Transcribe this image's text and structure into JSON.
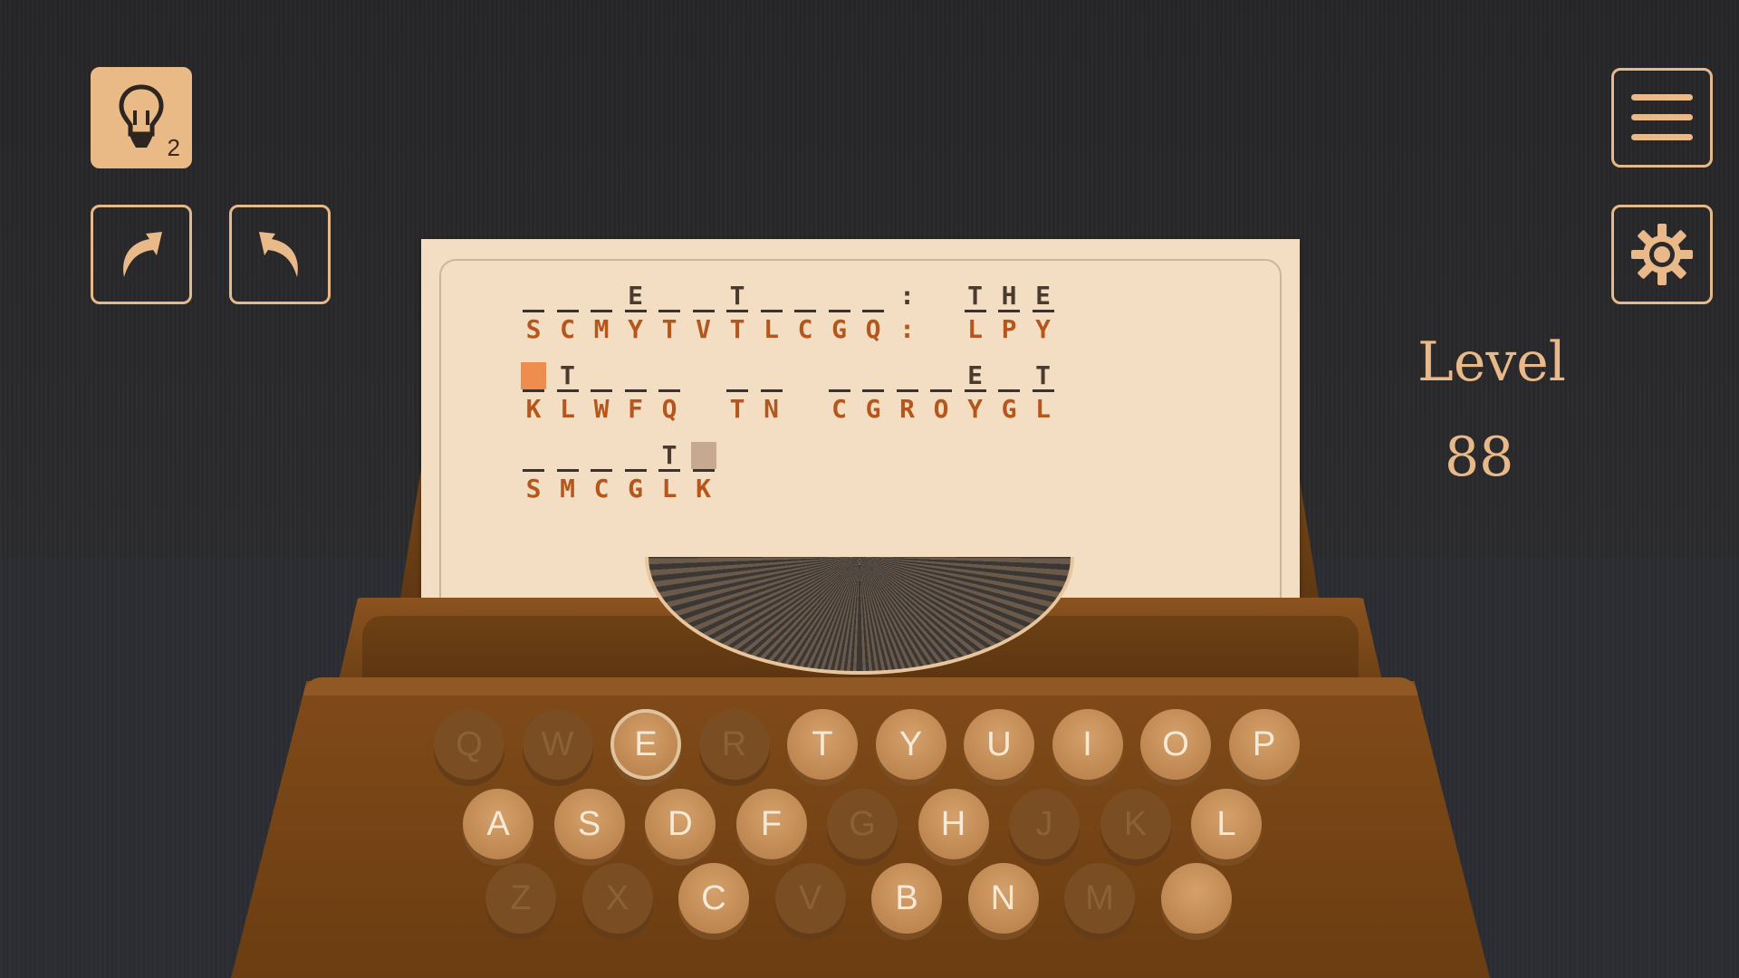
{
  "hints": {
    "count": "2"
  },
  "level": {
    "label": "Level",
    "value": "88"
  },
  "icons": {
    "hint": "lightbulb-icon",
    "undo": "undo-icon",
    "redo": "redo-icon",
    "menu": "menu-icon",
    "settings": "gear-icon"
  },
  "colors": {
    "accent": "#e9b98a",
    "selected": "#ef8d4f",
    "cipher": "#b5571d"
  },
  "puzzle": {
    "rows": [
      [
        {
          "code": "S",
          "guess": ""
        },
        {
          "code": "C",
          "guess": ""
        },
        {
          "code": "M",
          "guess": ""
        },
        {
          "code": "Y",
          "guess": "E"
        },
        {
          "code": "T",
          "guess": ""
        },
        {
          "code": "V",
          "guess": ""
        },
        {
          "code": "T",
          "guess": "T"
        },
        {
          "code": "L",
          "guess": ""
        },
        {
          "code": "C",
          "guess": ""
        },
        {
          "code": "G",
          "guess": ""
        },
        {
          "code": "Q",
          "guess": ""
        },
        {
          "code": ":",
          "guess": ":"
        },
        {
          "code": " ",
          "guess": " "
        },
        {
          "code": "L",
          "guess": "T"
        },
        {
          "code": "P",
          "guess": "H"
        },
        {
          "code": "Y",
          "guess": "E"
        }
      ],
      [
        {
          "code": "K",
          "guess": "",
          "selected": true
        },
        {
          "code": "L",
          "guess": "T"
        },
        {
          "code": "W",
          "guess": ""
        },
        {
          "code": "F",
          "guess": ""
        },
        {
          "code": "Q",
          "guess": ""
        },
        {
          "code": " ",
          "guess": " "
        },
        {
          "code": "T",
          "guess": ""
        },
        {
          "code": "N",
          "guess": ""
        },
        {
          "code": " ",
          "guess": " "
        },
        {
          "code": "C",
          "guess": ""
        },
        {
          "code": "G",
          "guess": ""
        },
        {
          "code": "R",
          "guess": ""
        },
        {
          "code": "O",
          "guess": ""
        },
        {
          "code": "Y",
          "guess": "E"
        },
        {
          "code": "G",
          "guess": ""
        },
        {
          "code": "L",
          "guess": "T"
        }
      ],
      [
        {
          "code": "S",
          "guess": ""
        },
        {
          "code": "M",
          "guess": ""
        },
        {
          "code": "C",
          "guess": ""
        },
        {
          "code": "G",
          "guess": ""
        },
        {
          "code": "L",
          "guess": "T"
        },
        {
          "code": "K",
          "guess": "",
          "related": true
        }
      ]
    ]
  },
  "keyboard": {
    "rows": [
      [
        {
          "k": "Q",
          "active": false
        },
        {
          "k": "W",
          "active": false
        },
        {
          "k": "E",
          "active": true,
          "selected": true
        },
        {
          "k": "R",
          "active": false
        },
        {
          "k": "T",
          "active": true
        },
        {
          "k": "Y",
          "active": true
        },
        {
          "k": "U",
          "active": true
        },
        {
          "k": "I",
          "active": true
        },
        {
          "k": "O",
          "active": true
        },
        {
          "k": "P",
          "active": true
        }
      ],
      [
        {
          "k": "A",
          "active": true
        },
        {
          "k": "S",
          "active": true
        },
        {
          "k": "D",
          "active": true
        },
        {
          "k": "F",
          "active": true
        },
        {
          "k": "G",
          "active": false
        },
        {
          "k": "H",
          "active": true
        },
        {
          "k": "J",
          "active": false
        },
        {
          "k": "K",
          "active": false
        },
        {
          "k": "L",
          "active": true
        }
      ],
      [
        {
          "k": "Z",
          "active": false
        },
        {
          "k": "X",
          "active": false
        },
        {
          "k": "C",
          "active": true
        },
        {
          "k": "V",
          "active": false
        },
        {
          "k": "B",
          "active": true
        },
        {
          "k": "N",
          "active": true
        },
        {
          "k": "M",
          "active": false
        },
        {
          "k": "",
          "active": true
        }
      ]
    ]
  }
}
